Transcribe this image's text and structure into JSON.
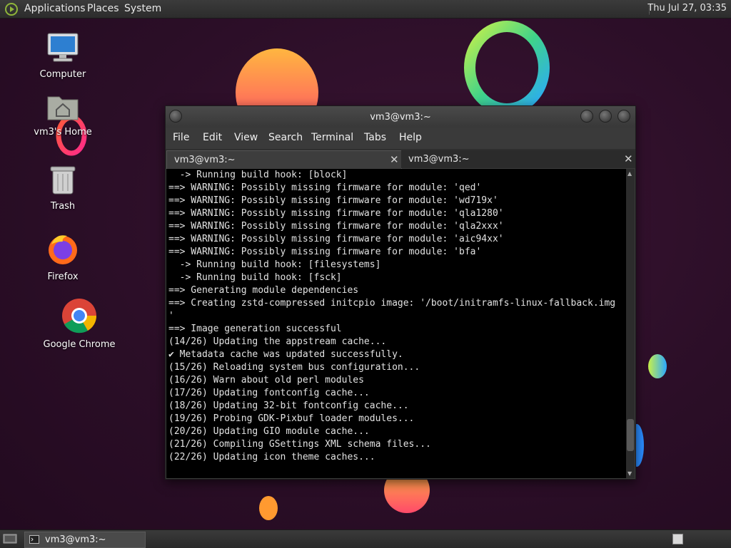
{
  "top_panel": {
    "menus": [
      "Applications",
      "Places",
      "System"
    ],
    "clock": "Thu Jul 27, 03:35"
  },
  "desktop_icons": [
    {
      "label": "Computer",
      "icon": "computer-icon"
    },
    {
      "label": "vm3's Home",
      "icon": "home-folder-icon"
    },
    {
      "label": "Trash",
      "icon": "trash-icon"
    },
    {
      "label": "Firefox",
      "icon": "firefox-icon"
    },
    {
      "label": "Google Chrome",
      "icon": "chrome-icon"
    }
  ],
  "terminal": {
    "title": "vm3@vm3:~",
    "menu": [
      "File",
      "Edit",
      "View",
      "Search",
      "Terminal",
      "Tabs",
      "Help"
    ],
    "tabs": [
      {
        "label": "vm3@vm3:~",
        "active": true
      },
      {
        "label": "vm3@vm3:~",
        "active": false
      }
    ],
    "lines": [
      "  -> Running build hook: [block]",
      "==> WARNING: Possibly missing firmware for module: 'qed'",
      "==> WARNING: Possibly missing firmware for module: 'wd719x'",
      "==> WARNING: Possibly missing firmware for module: 'qla1280'",
      "==> WARNING: Possibly missing firmware for module: 'qla2xxx'",
      "==> WARNING: Possibly missing firmware for module: 'aic94xx'",
      "==> WARNING: Possibly missing firmware for module: 'bfa'",
      "  -> Running build hook: [filesystems]",
      "  -> Running build hook: [fsck]",
      "==> Generating module dependencies",
      "==> Creating zstd-compressed initcpio image: '/boot/initramfs-linux-fallback.img",
      "'",
      "==> Image generation successful",
      "(14/26) Updating the appstream cache...",
      "✔ Metadata cache was updated successfully.",
      "(15/26) Reloading system bus configuration...",
      "(16/26) Warn about old perl modules",
      "(17/26) Updating fontconfig cache...",
      "(18/26) Updating 32-bit fontconfig cache...",
      "(19/26) Probing GDK-Pixbuf loader modules...",
      "(20/26) Updating GIO module cache...",
      "(21/26) Compiling GSettings XML schema files...",
      "(22/26) Updating icon theme caches..."
    ],
    "scroll_position": 0.93
  },
  "taskbar": {
    "window_label": "vm3@vm3:~"
  }
}
